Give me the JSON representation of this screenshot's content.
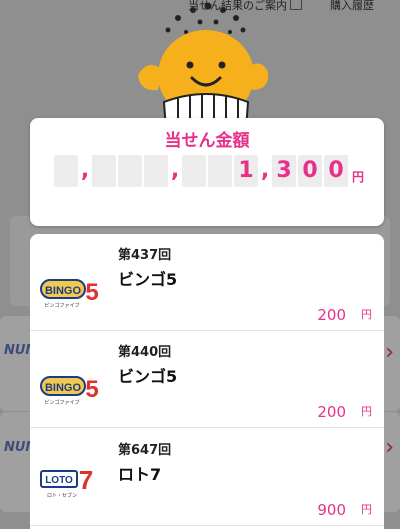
{
  "background": {
    "link_results": "当せん結果のご案内",
    "link_history": "購入履歴",
    "brand_1": "NUM",
    "brand_2": "NUM"
  },
  "total": {
    "title": "当せん金額",
    "digits": [
      "",
      ",",
      "",
      "",
      "",
      ",",
      "",
      "",
      "1",
      ",",
      "3",
      "0",
      "0"
    ],
    "currency": "円"
  },
  "results": [
    {
      "round": "第437回",
      "game": "ビンゴ5",
      "amount": "200",
      "currency": "円",
      "logo": "bingo5-logo"
    },
    {
      "round": "第440回",
      "game": "ビンゴ5",
      "amount": "200",
      "currency": "円",
      "logo": "bingo5-logo"
    },
    {
      "round": "第647回",
      "game": "ロト7",
      "amount": "900",
      "currency": "円",
      "logo": "loto7-logo"
    }
  ],
  "logos": {
    "bingo_text": "BINGO",
    "bingo_num": "5",
    "bingo_sub": "ビンゴファイブ",
    "loto_text": "LOTO",
    "loto_num": "7",
    "loto_sub": "ロト・セブン"
  },
  "colors": {
    "accent": "#e8308a",
    "mascot": "#f5b01c"
  }
}
